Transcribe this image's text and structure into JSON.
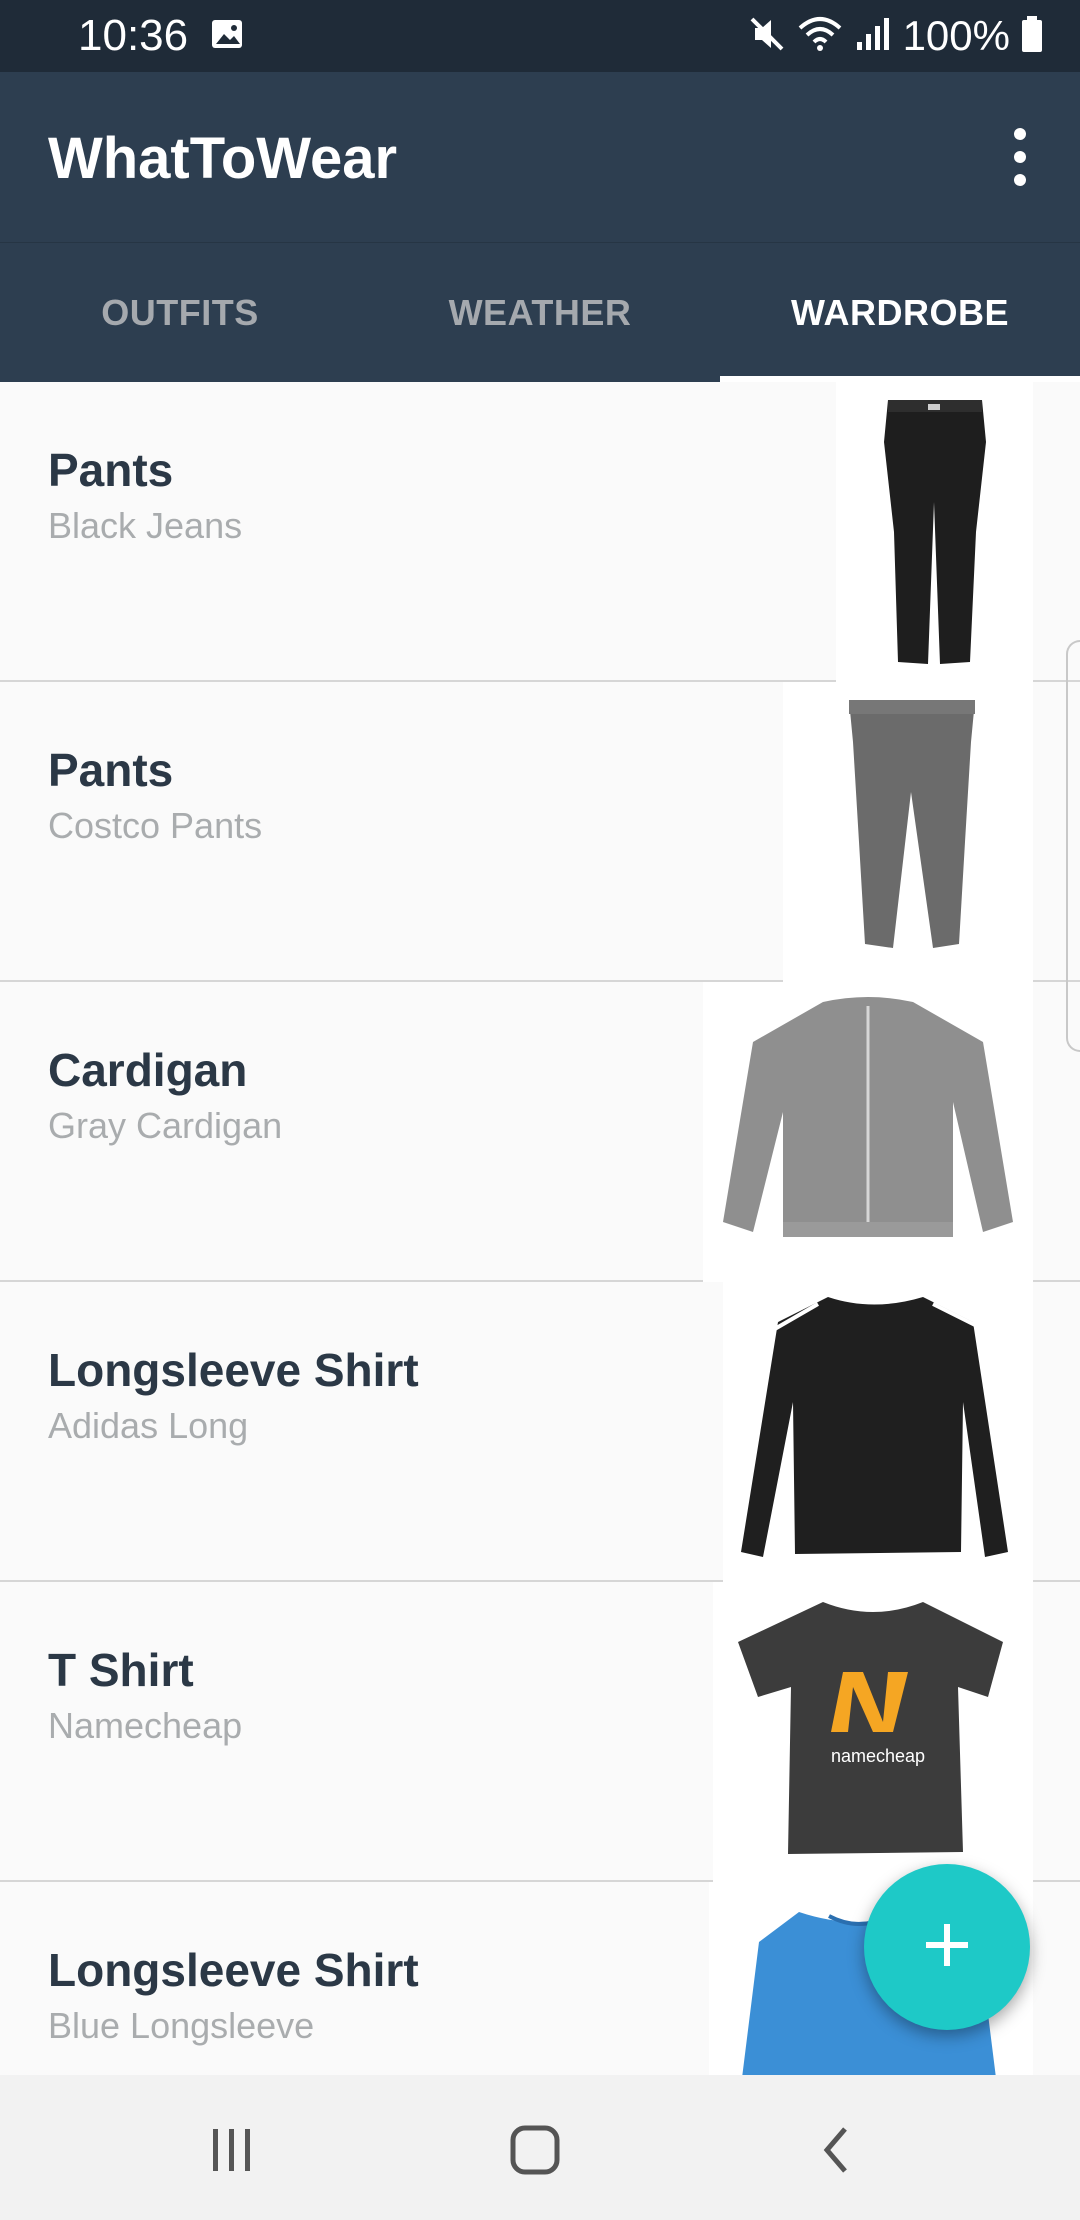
{
  "status_bar": {
    "time": "10:36",
    "battery": "100%",
    "icons": [
      "gallery-icon",
      "mute-icon",
      "wifi-icon",
      "signal-icon",
      "battery-icon"
    ]
  },
  "app": {
    "title": "WhatToWear",
    "overflow_icon": "more-vert-icon"
  },
  "tabs": [
    {
      "label": "OUTFITS",
      "active": false
    },
    {
      "label": "WEATHER",
      "active": false
    },
    {
      "label": "WARDROBE",
      "active": true
    }
  ],
  "wardrobe": [
    {
      "type": "Pants",
      "name": "Black Jeans",
      "image": "black-jeans-image"
    },
    {
      "type": "Pants",
      "name": "Costco Pants",
      "image": "gray-pants-image"
    },
    {
      "type": "Cardigan",
      "name": "Gray Cardigan",
      "image": "gray-cardigan-image"
    },
    {
      "type": "Longsleeve Shirt",
      "name": "Adidas Long",
      "image": "black-adidas-shirt-image"
    },
    {
      "type": "T Shirt",
      "name": "Namecheap",
      "image": "gray-namecheap-tshirt-image",
      "print_text": "namecheap"
    },
    {
      "type": "Longsleeve Shirt",
      "name": "Blue Longsleeve",
      "image": "blue-longsleeve-image"
    }
  ],
  "fab": {
    "icon": "plus-icon"
  },
  "nav": {
    "icons": [
      "recent-apps-icon",
      "home-icon",
      "back-icon"
    ]
  },
  "colors": {
    "app_bar": "#2d3e50",
    "status_bar": "#1f2b38",
    "accent": "#1ec9c7",
    "title_text": "#2b3846",
    "sub_text": "#a9acae"
  }
}
